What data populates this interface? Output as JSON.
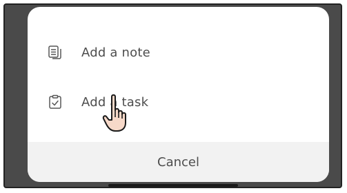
{
  "action_sheet": {
    "items": [
      {
        "label": "Add a note",
        "icon": "note-icon"
      },
      {
        "label": "Add a task",
        "icon": "task-clipboard-icon"
      }
    ],
    "cancel_label": "Cancel"
  },
  "cursor": {
    "icon": "hand-pointer-icon"
  },
  "colors": {
    "backdrop": "#4a4a4a",
    "sheet": "#ffffff",
    "cancel_bg": "#f2f2f2",
    "text": "#4d4d4d",
    "icon": "#555555"
  }
}
